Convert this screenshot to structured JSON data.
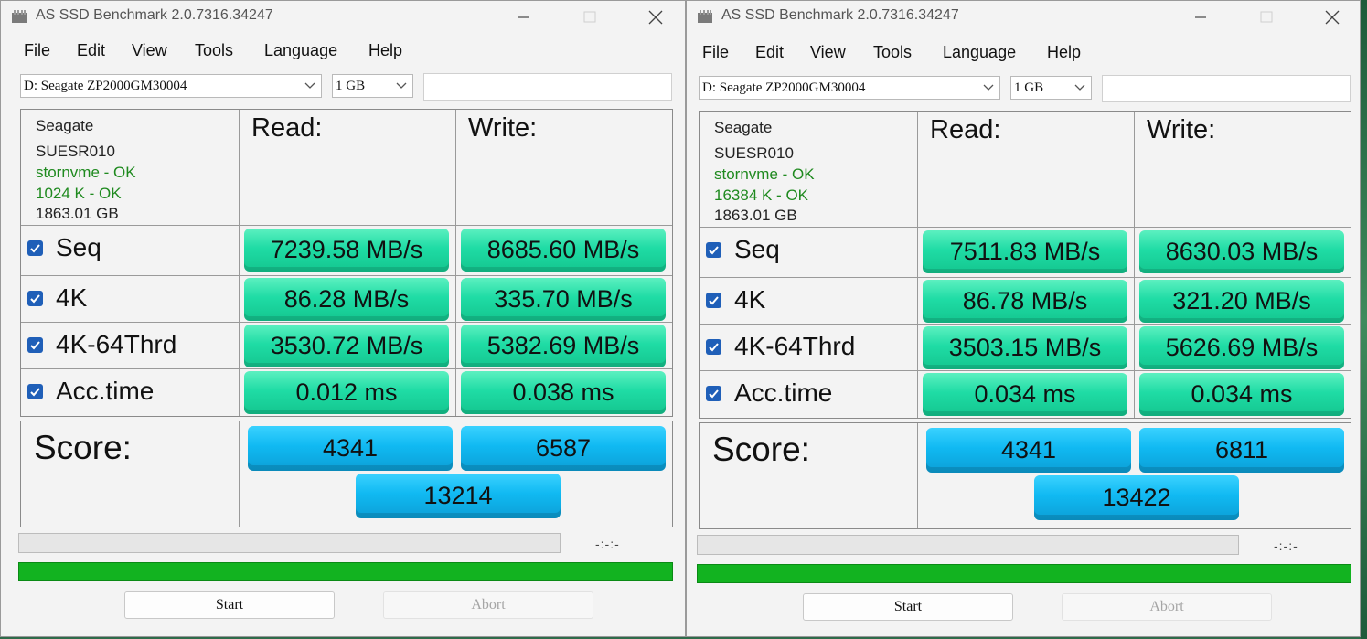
{
  "windows": [
    {
      "title": "AS SSD Benchmark 2.0.7316.34247",
      "menu": [
        "File",
        "Edit",
        "View",
        "Tools",
        "Language",
        "Help"
      ],
      "drive": "D: Seagate ZP2000GM30004",
      "size": "1 GB",
      "info": {
        "vendor": "Seagate",
        "firmware": "SUESR010",
        "driver": "stornvme - OK",
        "alignment": "1024 K - OK",
        "capacity": "1863.01 GB"
      },
      "headers": {
        "read": "Read:",
        "write": "Write:"
      },
      "tests": [
        {
          "label": "Seq",
          "checked": true,
          "read": "7239.58 MB/s",
          "write": "8685.60 MB/s"
        },
        {
          "label": "4K",
          "checked": true,
          "read": "86.28 MB/s",
          "write": "335.70 MB/s"
        },
        {
          "label": "4K-64Thrd",
          "checked": true,
          "read": "3530.72 MB/s",
          "write": "5382.69 MB/s"
        },
        {
          "label": "Acc.time",
          "checked": true,
          "read": "0.012 ms",
          "write": "0.038 ms"
        }
      ],
      "score": {
        "label": "Score:",
        "read": "4341",
        "write": "6587",
        "total": "13214"
      },
      "time_display": "-:-:-",
      "buttons": {
        "start": "Start",
        "abort": "Abort"
      }
    },
    {
      "title": "AS SSD Benchmark 2.0.7316.34247",
      "menu": [
        "File",
        "Edit",
        "View",
        "Tools",
        "Language",
        "Help"
      ],
      "drive": "D: Seagate ZP2000GM30004",
      "size": "1 GB",
      "info": {
        "vendor": "Seagate",
        "firmware": "SUESR010",
        "driver": "stornvme - OK",
        "alignment": "16384 K - OK",
        "capacity": "1863.01 GB"
      },
      "headers": {
        "read": "Read:",
        "write": "Write:"
      },
      "tests": [
        {
          "label": "Seq",
          "checked": true,
          "read": "7511.83 MB/s",
          "write": "8630.03 MB/s"
        },
        {
          "label": "4K",
          "checked": true,
          "read": "86.78 MB/s",
          "write": "321.20 MB/s"
        },
        {
          "label": "4K-64Thrd",
          "checked": true,
          "read": "3503.15 MB/s",
          "write": "5626.69 MB/s"
        },
        {
          "label": "Acc.time",
          "checked": true,
          "read": "0.034 ms",
          "write": "0.034 ms"
        }
      ],
      "score": {
        "label": "Score:",
        "read": "4341",
        "write": "6811",
        "total": "13422"
      },
      "time_display": "-:-:-",
      "buttons": {
        "start": "Start",
        "abort": "Abort"
      }
    }
  ],
  "colors": {
    "ok_text": "#1f8a1f",
    "result_cell": "#1fdca5",
    "score_cell": "#10b9f2",
    "progress_fill": "#12b320",
    "checkbox": "#1f5fb8"
  },
  "progress": {
    "fill_fraction": 1.0
  }
}
